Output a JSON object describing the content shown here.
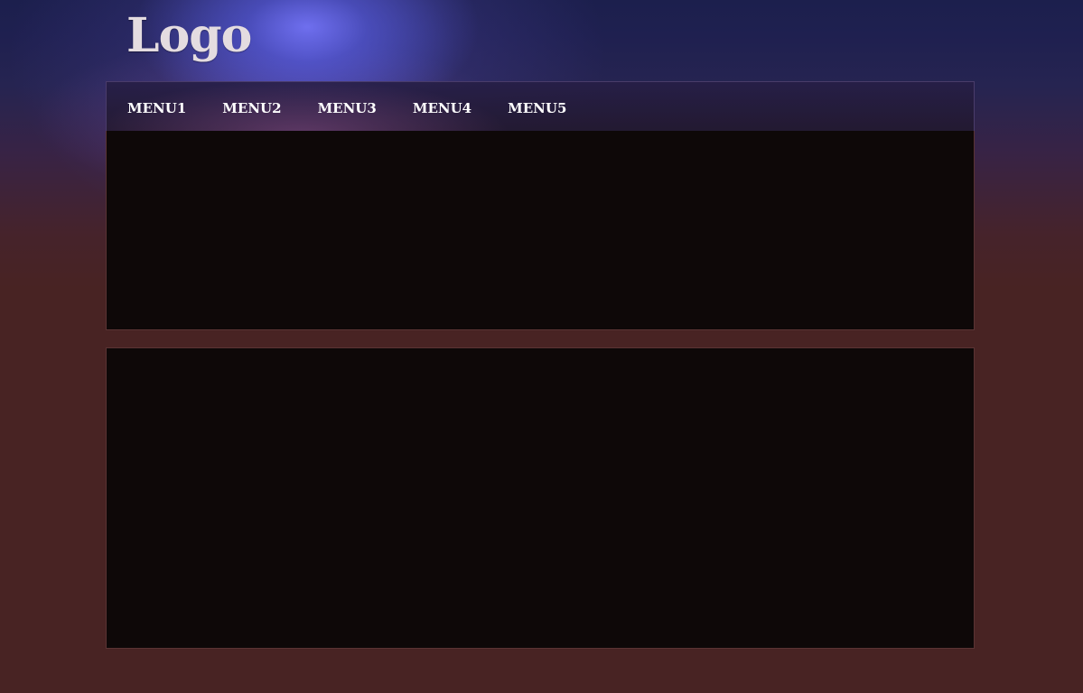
{
  "header": {
    "logo_text": "Logo"
  },
  "nav": {
    "items": [
      {
        "label": "MENU1"
      },
      {
        "label": "MENU2"
      },
      {
        "label": "MENU3"
      },
      {
        "label": "MENU4"
      },
      {
        "label": "MENU5"
      }
    ]
  },
  "colors": {
    "page_top": "#1c1f4d",
    "page_bottom": "#482323",
    "glow": "#6466ee",
    "panel_fill": "#0e0808",
    "panel_border": "#5a3434",
    "nav_text": "#ffffff",
    "logo_text": "#e4dce0"
  }
}
